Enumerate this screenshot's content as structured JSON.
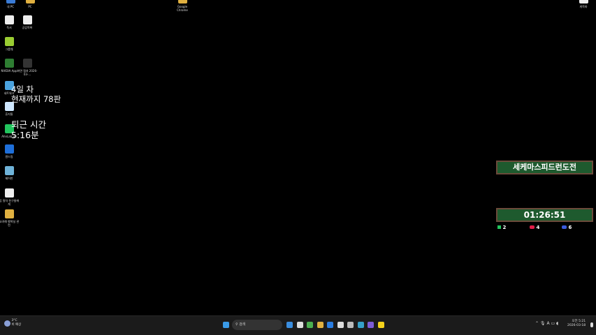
{
  "desktop_icons": [
    {
      "label": "내 PC",
      "color": "#3a7bd5"
    },
    {
      "label": "PC",
      "color": "#e0b040"
    },
    {
      "label": "독서",
      "color": "#eeeeee"
    },
    {
      "label": "공감목록",
      "color": "#eeeeee"
    },
    {
      "label": "그룹웨",
      "color": "#9acd32"
    },
    {
      "label": "NVIDIA App",
      "color": "#2e7d32"
    },
    {
      "label": "화면 캡처 2026-03-...",
      "color": "#333333"
    },
    {
      "label": "네트워크",
      "color": "#4aa3df"
    },
    {
      "label": "휴지통",
      "color": "#cfe8ff"
    },
    {
      "label": "AhnLab V3",
      "color": "#22c55e"
    },
    {
      "label": "원드림",
      "color": "#1e6fd9"
    },
    {
      "label": "제어판",
      "color": "#6fb3d9"
    },
    {
      "label": "업 절차 친구들에게",
      "color": "#eeeeee"
    },
    {
      "label": "고려해 행복실 관련",
      "color": "#e0b040"
    },
    {
      "label": "Google Chrome",
      "color": "#e0b040"
    },
    {
      "label": "게목파",
      "color": "#eeeeee"
    }
  ],
  "overlay": {
    "line1": "4일 차",
    "line2": "현재까지 78판",
    "line3": "퇴근 시간",
    "line4": "5:16분"
  },
  "widget": {
    "title": "세케마스피드런도전",
    "timer": "01:26:51",
    "stats": [
      {
        "value": "2",
        "color": "#22c55e"
      },
      {
        "value": "4",
        "color": "#e11d48"
      },
      {
        "value": "6",
        "color": "#3b5bdb"
      }
    ]
  },
  "taskbar": {
    "weather_temp": "3°C",
    "weather_desc": "비 예상",
    "search_placeholder": "검색",
    "time": "오전 5:21",
    "date": "2026-03-18",
    "lang": "A",
    "apps": [
      "#3a8dde",
      "#dddddd",
      "#4caf50",
      "#e0b040",
      "#2a7de1",
      "#dddddd",
      "#bbbbbb",
      "#35a0c8",
      "#7c5cd6",
      "#f5d21c"
    ]
  }
}
